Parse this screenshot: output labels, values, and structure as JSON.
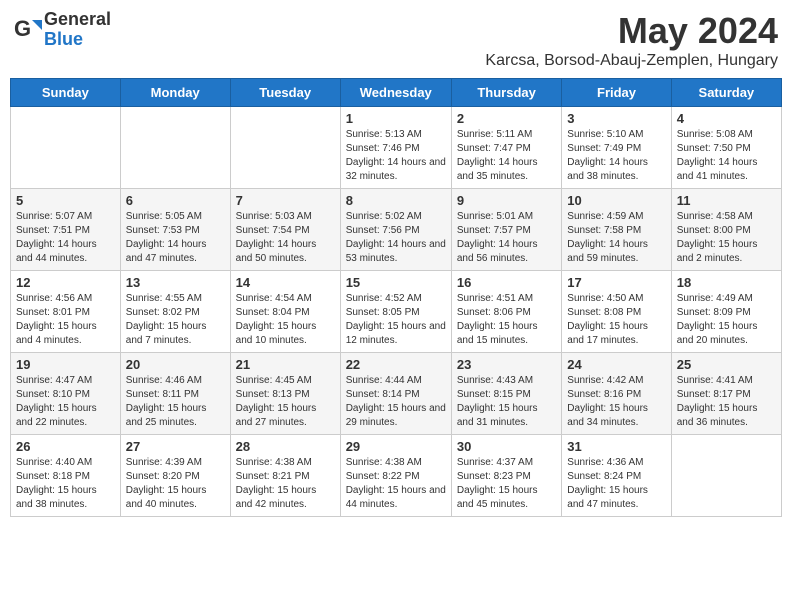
{
  "header": {
    "logo_general": "General",
    "logo_blue": "Blue",
    "month_year": "May 2024",
    "location": "Karcsa, Borsod-Abauj-Zemplen, Hungary"
  },
  "days_of_week": [
    "Sunday",
    "Monday",
    "Tuesday",
    "Wednesday",
    "Thursday",
    "Friday",
    "Saturday"
  ],
  "weeks": [
    [
      {
        "day": "",
        "info": ""
      },
      {
        "day": "",
        "info": ""
      },
      {
        "day": "",
        "info": ""
      },
      {
        "day": "1",
        "info": "Sunrise: 5:13 AM\nSunset: 7:46 PM\nDaylight: 14 hours and 32 minutes."
      },
      {
        "day": "2",
        "info": "Sunrise: 5:11 AM\nSunset: 7:47 PM\nDaylight: 14 hours and 35 minutes."
      },
      {
        "day": "3",
        "info": "Sunrise: 5:10 AM\nSunset: 7:49 PM\nDaylight: 14 hours and 38 minutes."
      },
      {
        "day": "4",
        "info": "Sunrise: 5:08 AM\nSunset: 7:50 PM\nDaylight: 14 hours and 41 minutes."
      }
    ],
    [
      {
        "day": "5",
        "info": "Sunrise: 5:07 AM\nSunset: 7:51 PM\nDaylight: 14 hours and 44 minutes."
      },
      {
        "day": "6",
        "info": "Sunrise: 5:05 AM\nSunset: 7:53 PM\nDaylight: 14 hours and 47 minutes."
      },
      {
        "day": "7",
        "info": "Sunrise: 5:03 AM\nSunset: 7:54 PM\nDaylight: 14 hours and 50 minutes."
      },
      {
        "day": "8",
        "info": "Sunrise: 5:02 AM\nSunset: 7:56 PM\nDaylight: 14 hours and 53 minutes."
      },
      {
        "day": "9",
        "info": "Sunrise: 5:01 AM\nSunset: 7:57 PM\nDaylight: 14 hours and 56 minutes."
      },
      {
        "day": "10",
        "info": "Sunrise: 4:59 AM\nSunset: 7:58 PM\nDaylight: 14 hours and 59 minutes."
      },
      {
        "day": "11",
        "info": "Sunrise: 4:58 AM\nSunset: 8:00 PM\nDaylight: 15 hours and 2 minutes."
      }
    ],
    [
      {
        "day": "12",
        "info": "Sunrise: 4:56 AM\nSunset: 8:01 PM\nDaylight: 15 hours and 4 minutes."
      },
      {
        "day": "13",
        "info": "Sunrise: 4:55 AM\nSunset: 8:02 PM\nDaylight: 15 hours and 7 minutes."
      },
      {
        "day": "14",
        "info": "Sunrise: 4:54 AM\nSunset: 8:04 PM\nDaylight: 15 hours and 10 minutes."
      },
      {
        "day": "15",
        "info": "Sunrise: 4:52 AM\nSunset: 8:05 PM\nDaylight: 15 hours and 12 minutes."
      },
      {
        "day": "16",
        "info": "Sunrise: 4:51 AM\nSunset: 8:06 PM\nDaylight: 15 hours and 15 minutes."
      },
      {
        "day": "17",
        "info": "Sunrise: 4:50 AM\nSunset: 8:08 PM\nDaylight: 15 hours and 17 minutes."
      },
      {
        "day": "18",
        "info": "Sunrise: 4:49 AM\nSunset: 8:09 PM\nDaylight: 15 hours and 20 minutes."
      }
    ],
    [
      {
        "day": "19",
        "info": "Sunrise: 4:47 AM\nSunset: 8:10 PM\nDaylight: 15 hours and 22 minutes."
      },
      {
        "day": "20",
        "info": "Sunrise: 4:46 AM\nSunset: 8:11 PM\nDaylight: 15 hours and 25 minutes."
      },
      {
        "day": "21",
        "info": "Sunrise: 4:45 AM\nSunset: 8:13 PM\nDaylight: 15 hours and 27 minutes."
      },
      {
        "day": "22",
        "info": "Sunrise: 4:44 AM\nSunset: 8:14 PM\nDaylight: 15 hours and 29 minutes."
      },
      {
        "day": "23",
        "info": "Sunrise: 4:43 AM\nSunset: 8:15 PM\nDaylight: 15 hours and 31 minutes."
      },
      {
        "day": "24",
        "info": "Sunrise: 4:42 AM\nSunset: 8:16 PM\nDaylight: 15 hours and 34 minutes."
      },
      {
        "day": "25",
        "info": "Sunrise: 4:41 AM\nSunset: 8:17 PM\nDaylight: 15 hours and 36 minutes."
      }
    ],
    [
      {
        "day": "26",
        "info": "Sunrise: 4:40 AM\nSunset: 8:18 PM\nDaylight: 15 hours and 38 minutes."
      },
      {
        "day": "27",
        "info": "Sunrise: 4:39 AM\nSunset: 8:20 PM\nDaylight: 15 hours and 40 minutes."
      },
      {
        "day": "28",
        "info": "Sunrise: 4:38 AM\nSunset: 8:21 PM\nDaylight: 15 hours and 42 minutes."
      },
      {
        "day": "29",
        "info": "Sunrise: 4:38 AM\nSunset: 8:22 PM\nDaylight: 15 hours and 44 minutes."
      },
      {
        "day": "30",
        "info": "Sunrise: 4:37 AM\nSunset: 8:23 PM\nDaylight: 15 hours and 45 minutes."
      },
      {
        "day": "31",
        "info": "Sunrise: 4:36 AM\nSunset: 8:24 PM\nDaylight: 15 hours and 47 minutes."
      },
      {
        "day": "",
        "info": ""
      }
    ]
  ]
}
